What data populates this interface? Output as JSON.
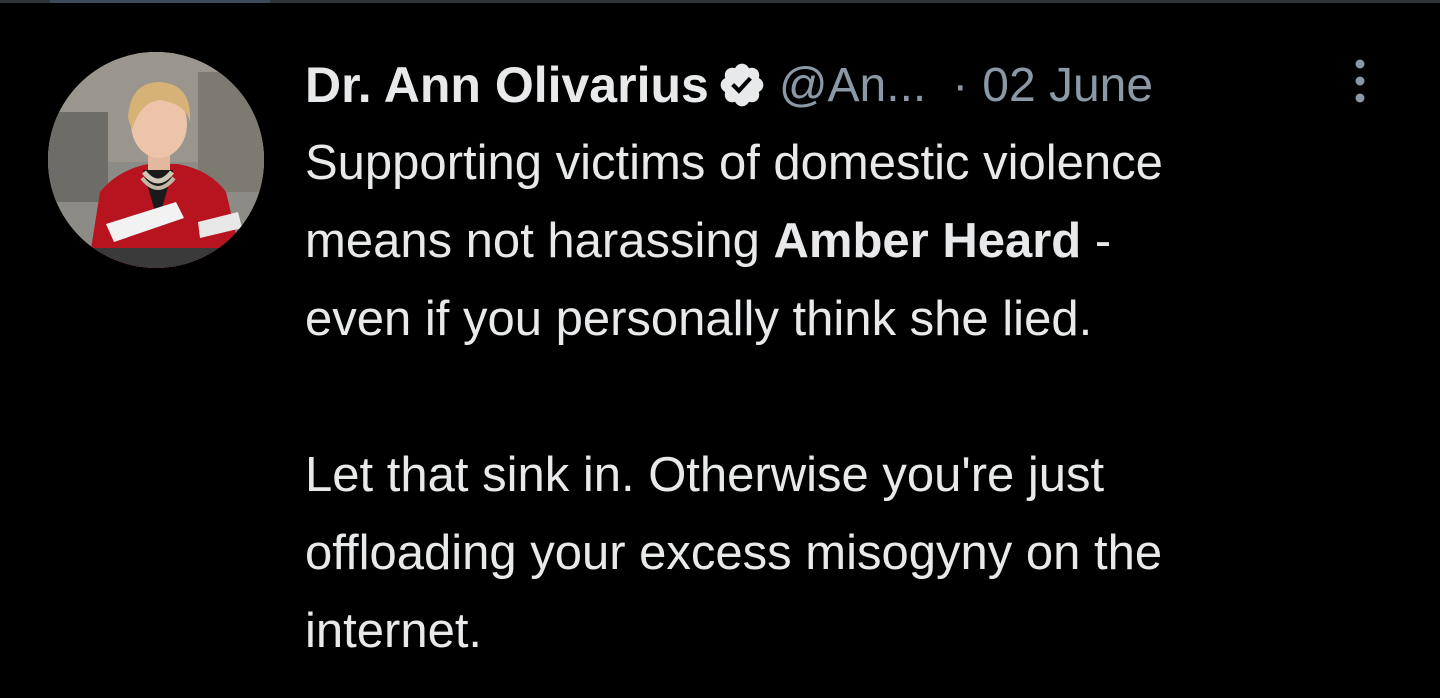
{
  "tweet": {
    "author": {
      "display_name": "Dr. Ann Olivarius",
      "handle": "@An...",
      "verified": true,
      "avatar_icon": "profile-photo"
    },
    "separator": "·",
    "date": "02 June",
    "more_icon": "more-options-icon",
    "text": {
      "line1": "Supporting victims of domestic violence",
      "line2_pre": "means not harassing ",
      "line2_bold": "Amber Heard",
      "line2_post": " -",
      "line3": "even if you personally think she lied.",
      "line4": "Let that sink in. Otherwise you're just",
      "line5": "offloading your excess misogyny on the",
      "line6": "internet."
    }
  },
  "colors": {
    "background": "#000000",
    "text_primary": "#e7e9ea",
    "text_secondary": "#8b98a5"
  }
}
